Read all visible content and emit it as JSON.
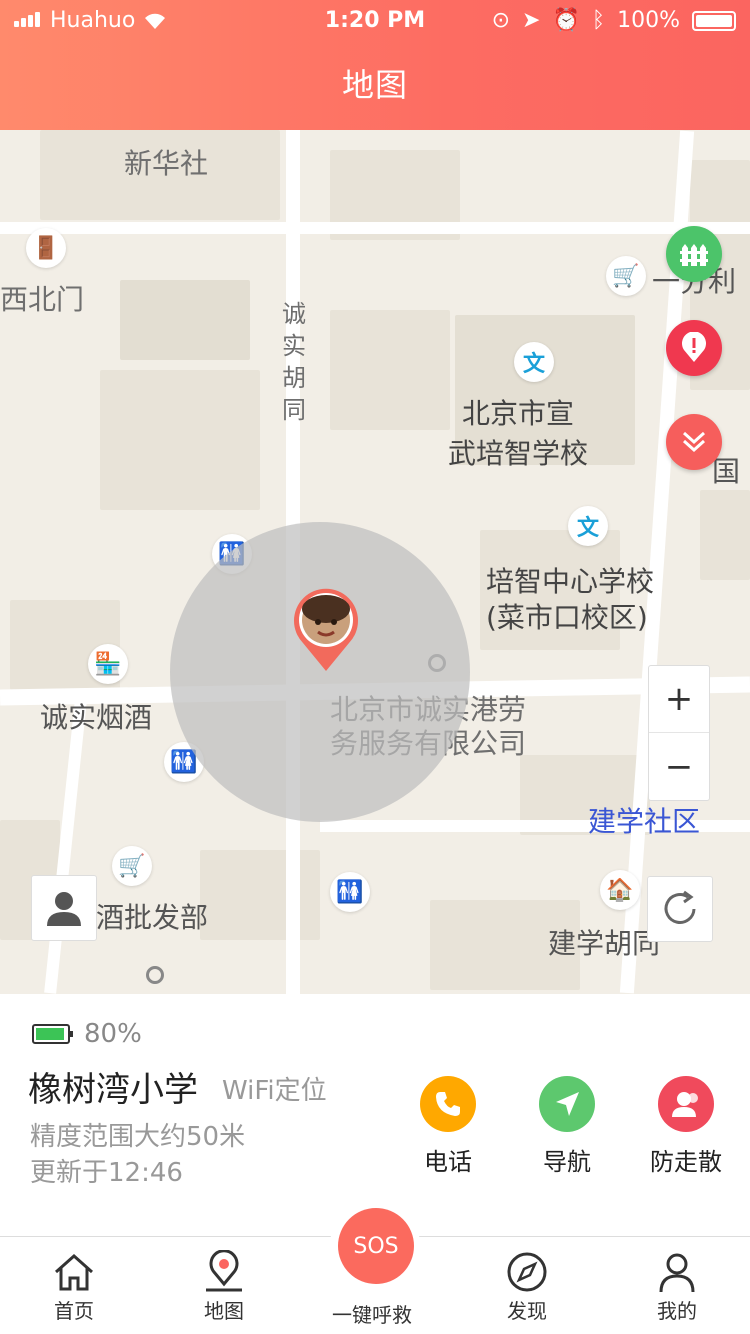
{
  "status": {
    "carrier": "Huahuo",
    "time": "1:20 PM",
    "battery": "100%"
  },
  "header": {
    "title": "地图"
  },
  "map": {
    "labels": [
      {
        "id": "xinhuashe",
        "text": "新华社"
      },
      {
        "id": "xibeimen",
        "text": "西北门"
      },
      {
        "id": "chengshi",
        "text": "诚实胡同"
      },
      {
        "id": "school1a",
        "text": "北京市宣"
      },
      {
        "id": "school1b",
        "text": "武培智学校"
      },
      {
        "id": "school2a",
        "text": "培智中心学校"
      },
      {
        "id": "school2b",
        "text": "(菜市口校区)"
      },
      {
        "id": "tobacco",
        "text": "诚实烟酒"
      },
      {
        "id": "company_a",
        "text": "北京市诚实港劳"
      },
      {
        "id": "company_b",
        "text": "务服务有限公司"
      },
      {
        "id": "jianxue",
        "text": "建学社区"
      },
      {
        "id": "pifa",
        "text": "酒批发部"
      },
      {
        "id": "hutong",
        "text": "建学胡同"
      },
      {
        "id": "yifenli",
        "text": "一分利"
      },
      {
        "id": "guo",
        "text": "国"
      }
    ],
    "poi_wen": "文",
    "zoom_in": "+",
    "zoom_out": "−"
  },
  "info": {
    "battery_level": "80%",
    "battery_fraction": 0.8,
    "place": "橡树湾小学",
    "location_type": "WiFi定位",
    "accuracy": "精度范围大约50米",
    "updated": "更新于12:46",
    "actions": [
      {
        "label": "电话",
        "color": "#ffa800",
        "icon": "phone-icon"
      },
      {
        "label": "导航",
        "color": "#5dc86e",
        "icon": "navigate-icon"
      },
      {
        "label": "防走散",
        "color": "#f04a5c",
        "icon": "guard-icon"
      }
    ]
  },
  "tabs": [
    {
      "label": "首页",
      "icon": "home-icon"
    },
    {
      "label": "地图",
      "icon": "map-pin-icon"
    },
    {
      "label": "一键呼救",
      "icon": "sos-icon"
    },
    {
      "label": "发现",
      "icon": "compass-icon"
    },
    {
      "label": "我的",
      "icon": "user-icon"
    }
  ],
  "sos": "SOS",
  "colors": {
    "accent": "#fb6560",
    "header_start": "#ff8a6c",
    "green": "#5dc86e",
    "yellow": "#ffa800",
    "red": "#f04a5c"
  }
}
